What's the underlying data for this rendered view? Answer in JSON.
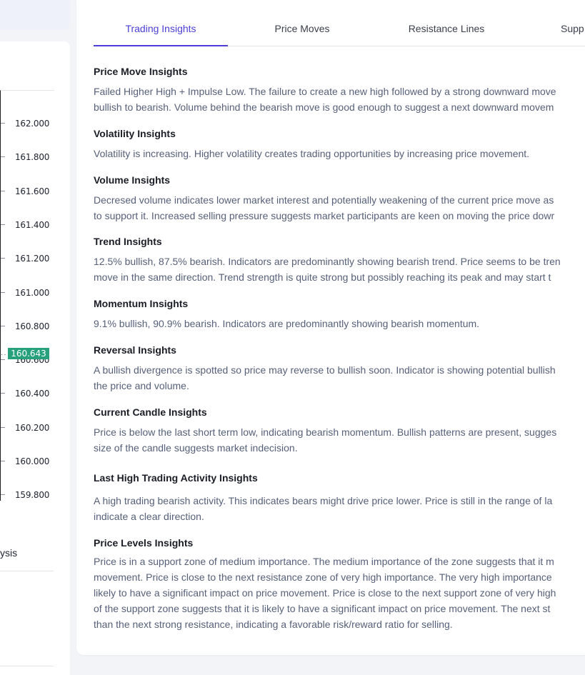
{
  "left_panel": {
    "price_ticks": [
      "162.000",
      "161.800",
      "161.600",
      "161.400",
      "161.200",
      "161.000",
      "160.800",
      "160.600",
      "160.400",
      "160.200",
      "160.000",
      "159.800"
    ],
    "current_price": "160.643",
    "link_text": "ysis"
  },
  "tabs": [
    {
      "label": "Trading Insights",
      "active": true
    },
    {
      "label": "Price Moves",
      "active": false
    },
    {
      "label": "Resistance Lines",
      "active": false
    },
    {
      "label": "Supp",
      "active": false
    }
  ],
  "insights": [
    {
      "title": "Price Move Insights",
      "lines": [
        "Failed Higher High + Impulse Low. The failure to create a new high followed by a strong downward move",
        "bullish to bearish. Volume behind the bearish move is good enough to suggest a next downward movem"
      ]
    },
    {
      "title": "Volatility Insights",
      "lines": [
        "Volatility is increasing. Higher volatility creates trading opportunities by increasing price movement."
      ]
    },
    {
      "title": "Volume Insights",
      "lines": [
        "Decresed volume indicates lower market interest and potentially weakening of the current price move as",
        "to support it. Increased selling pressure suggests market participants are keen on moving the price dowr"
      ]
    },
    {
      "title": "Trend Insights",
      "lines": [
        "12.5% bullish, 87.5% bearish. Indicators are predominantly showing bearish trend. Price seems to be tren",
        "move in the same direction. Trend strength is quite strong but possibly reaching its peak and may start t"
      ]
    },
    {
      "title": "Momentum Insights",
      "lines": [
        "9.1% bullish, 90.9% bearish. Indicators are predominantly showing bearish momentum."
      ]
    },
    {
      "title": "Reversal Insights",
      "lines": [
        "A bullish divergence is spotted so price may reverse to bullish soon. Indicator is showing potential bullish",
        "the price and volume."
      ]
    },
    {
      "title": "Current Candle Insights",
      "lines": [
        "Price is below the last short term low, indicating bearish momentum. Bullish patterns are present, sugges",
        "size of the candle suggests market indecision."
      ]
    },
    {
      "title": "Last High Trading Activity Insights",
      "lines": [
        "A high trading bearish activity. This indicates bears might drive price lower. Price is still in the range of la",
        "indicate a clear direction."
      ]
    },
    {
      "title": "Price Levels Insights",
      "lines": [
        "Price is in a support zone of medium importance. The medium importance of the zone suggests that it m",
        "movement. Price is close to the next resistance zone of very high importance. The very high importance",
        "likely to have a significant impact on price movement. Price is close to the next support zone of very high",
        "of the support zone suggests that it is likely to have a significant impact on price movement. The next st",
        "than the next strong resistance, indicating a favorable risk/reward ratio for selling."
      ]
    }
  ]
}
